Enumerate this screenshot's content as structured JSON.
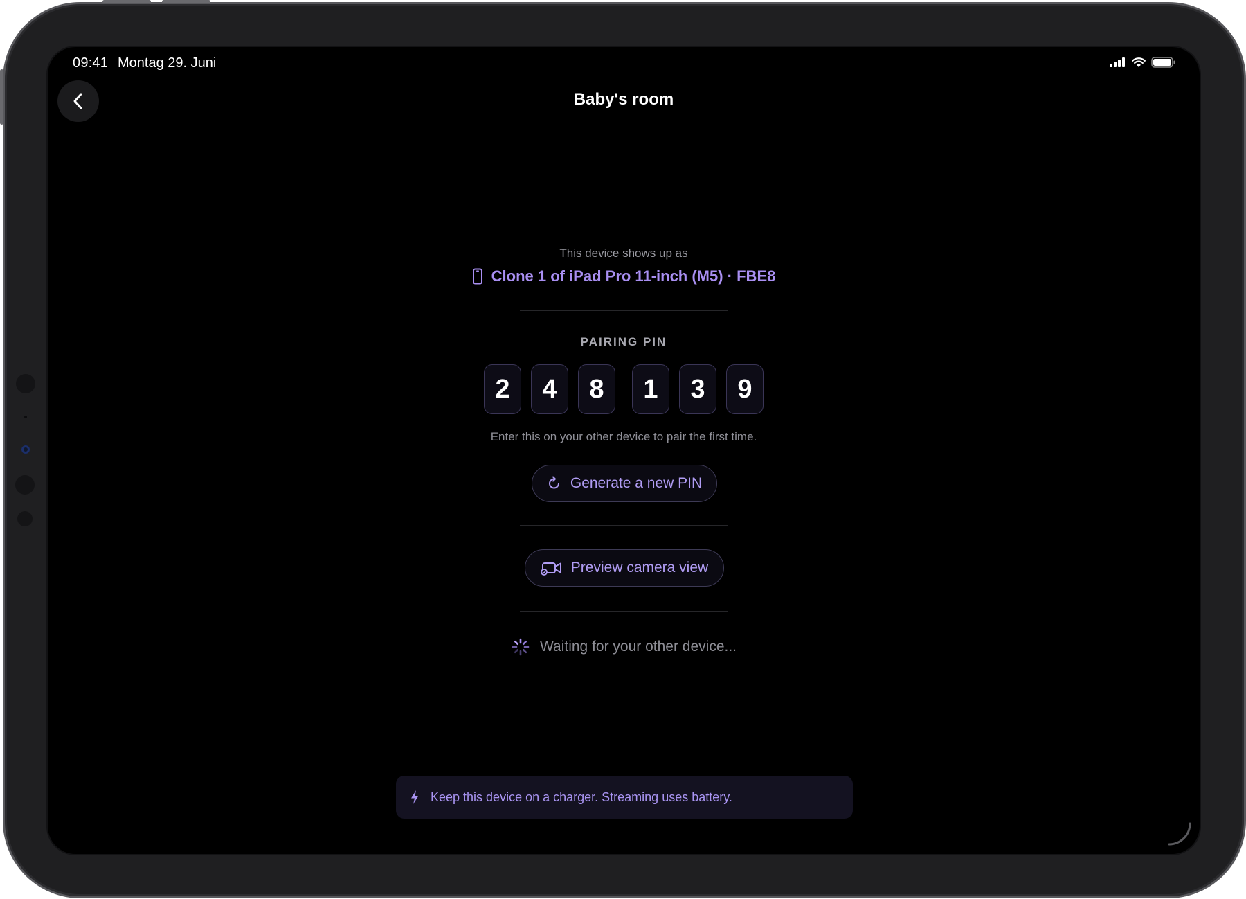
{
  "status_bar": {
    "time": "09:41",
    "date": "Montag 29. Juni",
    "icons": [
      "cellular-signal-icon",
      "wifi-icon",
      "battery-icon"
    ]
  },
  "nav": {
    "back_icon": "chevron-left-icon",
    "title": "Baby's room"
  },
  "device": {
    "shows_up_label": "This device shows up as",
    "icon": "phone-icon",
    "name": "Clone 1 of iPad Pro 11-inch (M5) · FBE8"
  },
  "pairing": {
    "label": "PAIRING PIN",
    "digits": [
      "2",
      "4",
      "8",
      "1",
      "3",
      "9"
    ],
    "hint": "Enter this on your other device to pair the first time.",
    "generate_button": {
      "icon": "refresh-icon",
      "label": "Generate a new PIN"
    }
  },
  "preview_button": {
    "icon": "video-camera-icon",
    "label": "Preview camera view"
  },
  "waiting": {
    "icon": "spinner-icon",
    "text": "Waiting for your other device..."
  },
  "banner": {
    "icon": "bolt-icon",
    "text": "Keep this device on a charger. Streaming uses battery."
  },
  "colors": {
    "accent": "#a98ff2",
    "background": "#000000",
    "banner_background": "#141221"
  }
}
